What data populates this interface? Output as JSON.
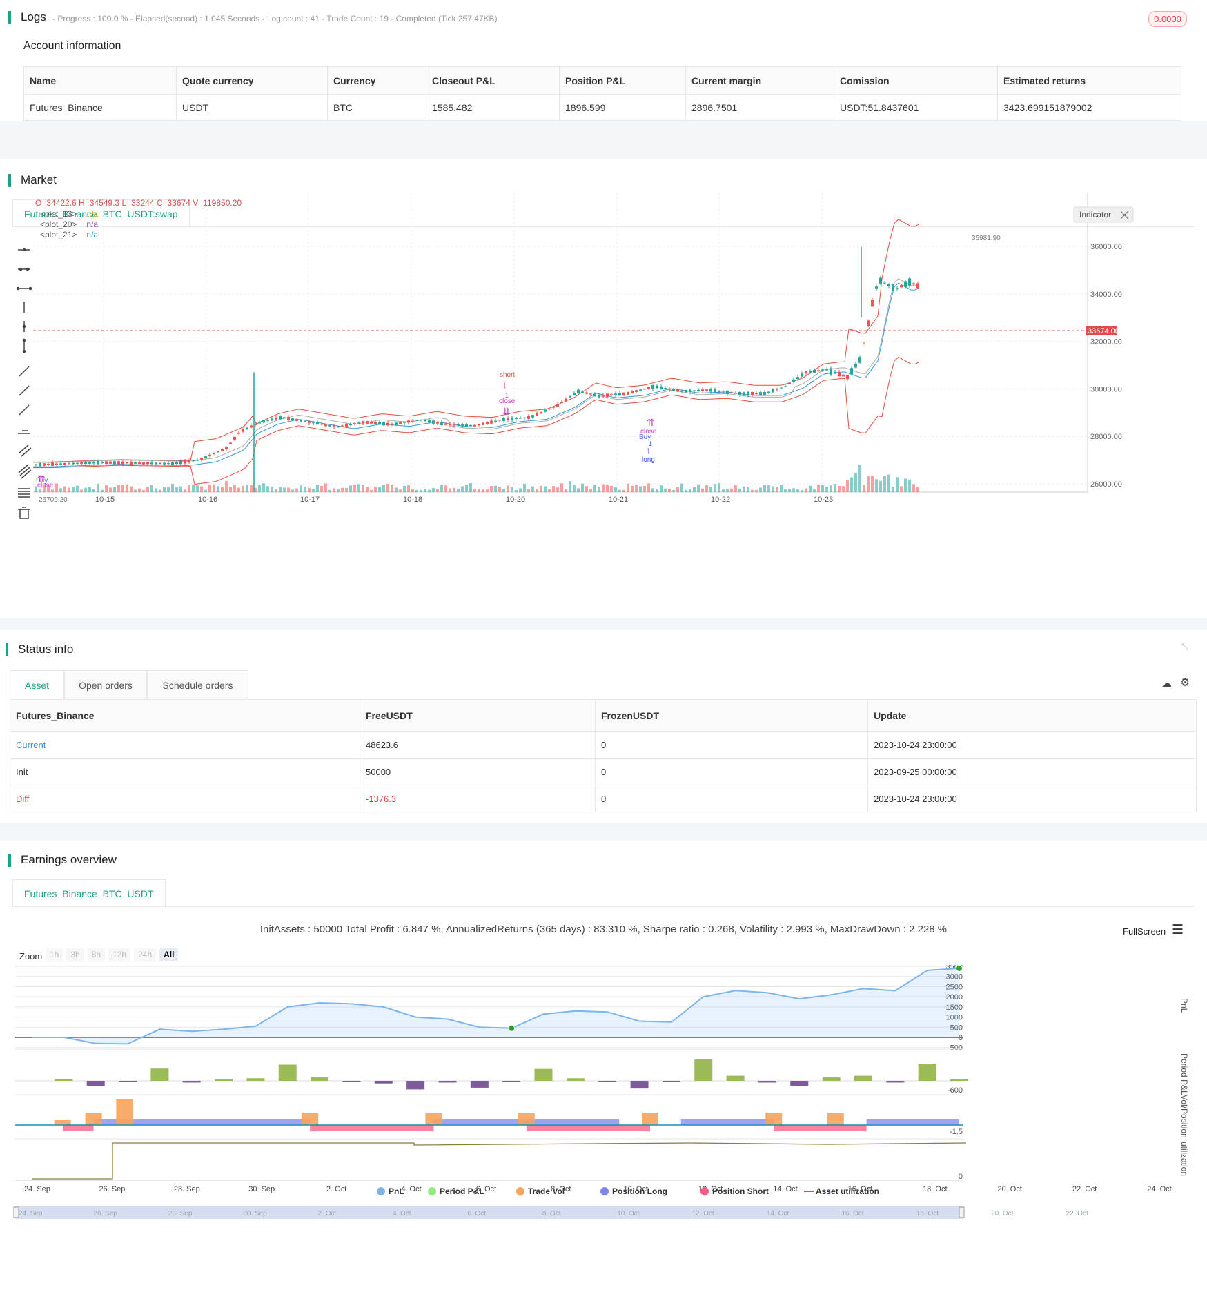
{
  "logs": {
    "title": "Logs",
    "status": "- Progress : 100.0 % - Elapsed(second) : 1.045  Seconds - Log count : 41 - Trade Count : 19 - Completed (Tick 257.47KB)",
    "badge": "0.0000"
  },
  "account": {
    "title": "Account information",
    "headers": [
      "Name",
      "Quote currency",
      "Currency",
      "Closeout P&L",
      "Position P&L",
      "Current margin",
      "Comission",
      "Estimated returns"
    ],
    "row": [
      "Futures_Binance",
      "USDT",
      "BTC",
      "1585.482",
      "1896.599",
      "2896.7501",
      "USDT:51.8437601",
      "3423.699151879002"
    ]
  },
  "market": {
    "title": "Market",
    "tab": "Futures_Binance_BTC_USDT:swap",
    "ohlc": "O=34422.6 H=34549.3 L=33244 C=33674 V=119850.20",
    "legend": [
      {
        "name": "<plot_13>",
        "value": "n/a",
        "color": "#f39c12"
      },
      {
        "name": "<plot_20>",
        "value": "n/a",
        "color": "#8e44ad"
      },
      {
        "name": "<plot_21>",
        "value": "n/a",
        "color": "#3498db"
      }
    ],
    "indicator_button": "Indicator",
    "price_ticks": [
      "36000.00",
      "34000.00",
      "32000.00",
      "30000.00",
      "28000.00",
      "26000.00"
    ],
    "current_price": "33674.00",
    "high_label": "35981.90",
    "low_label": "26709.20",
    "date_ticks": [
      "10-15",
      "10-16",
      "10-17",
      "10-18",
      "10-20",
      "10-21",
      "10-22",
      "10-23"
    ],
    "signals": {
      "short": "short",
      "close": "close",
      "buy": "Buy",
      "long": "long",
      "one": "1"
    }
  },
  "status": {
    "title": "Status info",
    "tabs": [
      "Asset",
      "Open orders",
      "Schedule orders"
    ],
    "headers": [
      "Futures_Binance",
      "FreeUSDT",
      "FrozenUSDT",
      "Update"
    ],
    "rows": [
      [
        "Current",
        "48623.6",
        "0",
        "2023-10-24 23:00:00"
      ],
      [
        "Init",
        "50000",
        "0",
        "2023-09-25 00:00:00"
      ],
      [
        "Diff",
        "-1376.3",
        "0",
        "2023-10-24 23:00:00"
      ]
    ]
  },
  "earnings": {
    "title": "Earnings overview",
    "tab": "Futures_Binance_BTC_USDT",
    "summary": "InitAssets : 50000 Total Profit : 6.847 %, AnnualizedReturns (365 days) : 83.310 %, Sharpe ratio : 0.268, Volatility : 2.993 %, MaxDrawDown : 2.228 %",
    "fullscreen": "FullScreen",
    "zoom_label": "Zoom",
    "zoom_options": [
      "1h",
      "3h",
      "8h",
      "12h",
      "24h",
      "All"
    ],
    "pnl_ticks": [
      "3500",
      "3000",
      "2500",
      "2000",
      "1500",
      "1000",
      "500",
      "0",
      "-500"
    ],
    "axis_names": [
      "PnL",
      "Period P&L",
      "Vol/Position",
      "utilization"
    ],
    "period_tick": "-600",
    "vol_tick": "-1.5",
    "util_tick": "0",
    "date_ticks": [
      "24. Sep",
      "26. Sep",
      "28. Sep",
      "30. Sep",
      "2. Oct",
      "4. Oct",
      "6. Oct",
      "8. Oct",
      "10. Oct",
      "12. Oct",
      "14. Oct",
      "16. Oct",
      "18. Oct",
      "20. Oct",
      "22. Oct",
      "24. Oct"
    ],
    "nav_ticks": [
      "24. Sep",
      "26. Sep",
      "28. Sep",
      "30. Sep",
      "2. Oct",
      "4. Oct",
      "6. Oct",
      "8. Oct",
      "10. Oct",
      "12. Oct",
      "14. Oct",
      "16. Oct",
      "18. Oct",
      "20. Oct",
      "22. Oct"
    ],
    "legend": [
      {
        "name": "PnL",
        "color": "#7cb5ec"
      },
      {
        "name": "Period P&L",
        "color": "#90ed7d"
      },
      {
        "name": "Trade Vol",
        "color": "#f7a35c"
      },
      {
        "name": "Position Long",
        "color": "#8085e9"
      },
      {
        "name": "Position Short",
        "color": "#f15c80"
      },
      {
        "name": "Asset utilization",
        "color": "#8b7d3a"
      }
    ]
  },
  "chart_data": {
    "type": "line",
    "x": [
      "24. Sep",
      "26. Sep",
      "27. Sep",
      "28. Sep",
      "29. Sep",
      "30. Sep",
      "1. Oct",
      "2. Oct",
      "3. Oct",
      "4. Oct",
      "5. Oct",
      "6. Oct",
      "7. Oct",
      "8. Oct",
      "9. Oct",
      "10. Oct",
      "11. Oct",
      "12. Oct",
      "13. Oct",
      "14. Oct",
      "15. Oct",
      "16. Oct",
      "17. Oct",
      "18. Oct",
      "19. Oct",
      "20. Oct",
      "21. Oct",
      "22. Oct",
      "23. Oct",
      "24. Oct"
    ],
    "series": [
      {
        "name": "PnL",
        "values": [
          0,
          0,
          -300,
          -320,
          400,
          300,
          400,
          550,
          1500,
          1700,
          1650,
          1500,
          1000,
          900,
          500,
          450,
          1150,
          1300,
          1250,
          800,
          750,
          2000,
          2300,
          2200,
          1900,
          2100,
          2400,
          2300,
          3300,
          3400
        ]
      }
    ],
    "ylim": [
      -500,
      3500
    ],
    "ylabel": "PnL"
  }
}
